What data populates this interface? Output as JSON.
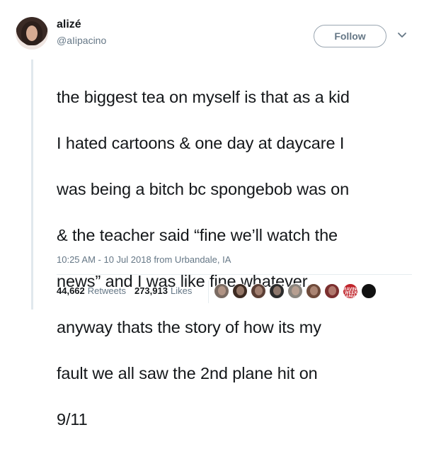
{
  "user": {
    "name": "alizé",
    "handle": "@aIipacino"
  },
  "follow_button": {
    "label": "Follow"
  },
  "tweet": {
    "lines": [
      "the biggest tea on myself is that as a kid",
      "I hated cartoons & one day at daycare I",
      "was being a bitch bc spongebob was on",
      "& the teacher said “fine we’ll watch the",
      "news” and I was like fine whatever.",
      "anyway thats the story of how its my",
      "fault we all saw the 2nd plane hit on",
      "9/11"
    ],
    "timestamp": "10:25 AM - 10 Jul 2018 from Urbandale, IA"
  },
  "stats": {
    "retweets_count": "44,662",
    "retweets_label": "Retweets",
    "likes_count": "273,913",
    "likes_label": "Likes"
  },
  "likers": [
    {
      "icon": "liker-avatar",
      "color": "#7a6b62"
    },
    {
      "icon": "liker-avatar",
      "color": "#3d2b22"
    },
    {
      "icon": "liker-avatar",
      "color": "#5b3f35"
    },
    {
      "icon": "liker-avatar",
      "color": "#2b2b2b"
    },
    {
      "icon": "liker-avatar",
      "color": "#8a857e"
    },
    {
      "icon": "liker-avatar",
      "color": "#6e4a3a"
    },
    {
      "icon": "liker-avatar",
      "color": "#7b2f2f"
    },
    {
      "icon": "liker-badge",
      "color": "#c0242b",
      "text": "RAVING WEEK FANIAS"
    },
    {
      "icon": "liker-avatar",
      "color": "#111111"
    }
  ]
}
